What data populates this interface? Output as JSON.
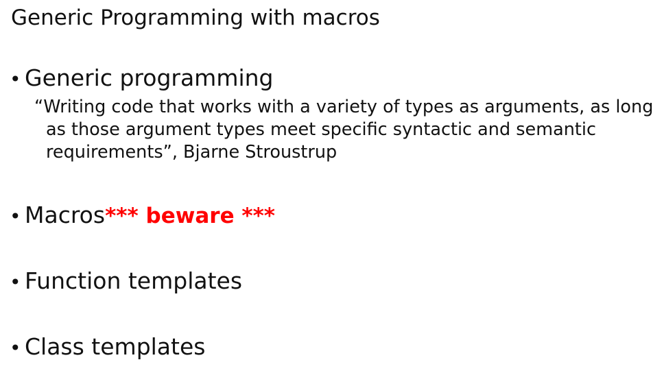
{
  "slide": {
    "title": "Generic Programming with macros",
    "bullet_glyph": "•",
    "bullets": [
      {
        "label": "Generic programming"
      },
      {
        "label": "Macros",
        "warning": "*** beware ***"
      },
      {
        "label": "Function templates"
      },
      {
        "label": "Class templates"
      }
    ],
    "quote": "“Writing code that works with a variety of types as arguments, as long as those argument types meet specific syntactic and semantic requirements”,  Bjarne Stroustrup"
  },
  "colors": {
    "text": "#111111",
    "warning": "#ff0000",
    "background": "#ffffff"
  }
}
